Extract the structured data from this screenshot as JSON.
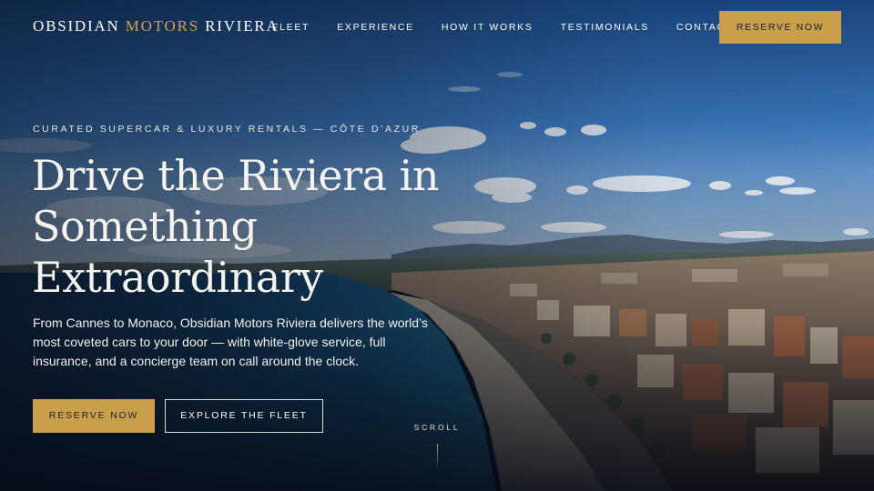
{
  "header": {
    "brand": {
      "part1": "OBSIDIAN",
      "part2": "MOTORS",
      "part3": "RIVIERA"
    },
    "nav": [
      {
        "label": "FLEET"
      },
      {
        "label": "EXPERIENCE"
      },
      {
        "label": "HOW IT WORKS"
      },
      {
        "label": "TESTIMONIALS"
      },
      {
        "label": "CONTACT"
      }
    ],
    "cta_label": "RESERVE NOW"
  },
  "hero": {
    "eyebrow": "CURATED SUPERCAR & LUXURY RENTALS — CÔTE D’AZUR",
    "headline": {
      "line1": "Drive the Riviera in",
      "line2": "Something",
      "line3": "Extraordinary"
    },
    "lede": "From Cannes to Monaco, Obsidian Motors Riviera delivers the world’s most coveted cars to your door — with white-glove service, full insurance, and a concierge team on call around the clock.",
    "primary_button": "RESERVE NOW",
    "secondary_button": "EXPLORE THE FLEET",
    "scroll_label": "SCROLL"
  },
  "theme": {
    "accent": "#c9a049",
    "sky": "#2f6bb0",
    "sea": "#0f3a5c",
    "text": "#ffffff"
  }
}
